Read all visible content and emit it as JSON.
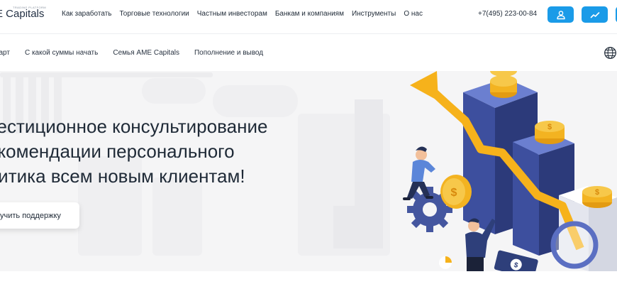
{
  "header": {
    "logo_tagline": "TRADING PLATFORM",
    "logo_text": "E Capitals",
    "nav": [
      {
        "label": "Как заработать"
      },
      {
        "label": "Торговые технологии"
      },
      {
        "label": "Частным инвесторам"
      },
      {
        "label": "Банкам и компаниям"
      },
      {
        "label": "Инструменты"
      },
      {
        "label": "О нас"
      }
    ],
    "phone": "+7(495) 223-00-84",
    "buttons": [
      {
        "icon": "user-icon"
      },
      {
        "icon": "chart-trend-icon"
      },
      {
        "icon": "partial-button"
      }
    ]
  },
  "subnav": {
    "items": [
      {
        "label": "тарт"
      },
      {
        "label": "С какой суммы начать"
      },
      {
        "label": "Семья AME Capitals"
      },
      {
        "label": "Пополнение и вывод"
      }
    ],
    "language_icon": "globe-icon"
  },
  "hero": {
    "title_lines": [
      "вестиционное консультирование",
      "екомендации персонального",
      "литика всем новым клиентам!"
    ],
    "cta_label": "учить поддержку",
    "illustration": "finance-growth-illustration"
  },
  "colors": {
    "accent": "#1a9be8",
    "text": "#1f2a37",
    "hero_bg": "#f5f5f6",
    "arrow": "#f6b21b",
    "cube": "#3d4f9e"
  }
}
